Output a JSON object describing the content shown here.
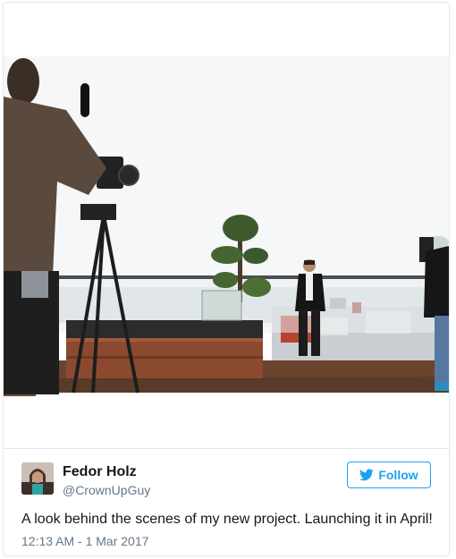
{
  "tweet": {
    "author_name": "Fedor Holz",
    "author_handle": "@CrownUpGuy",
    "follow_label": "Follow",
    "text": "A look behind the scenes of my new project. Launching it in April!",
    "timestamp": "12:13 AM - 1 Mar 2017"
  },
  "icons": {
    "follow": "twitter-bird-icon"
  },
  "colors": {
    "accent": "#1da1f2",
    "text": "#14171a",
    "muted": "#657786",
    "border": "#e1e8ed"
  }
}
